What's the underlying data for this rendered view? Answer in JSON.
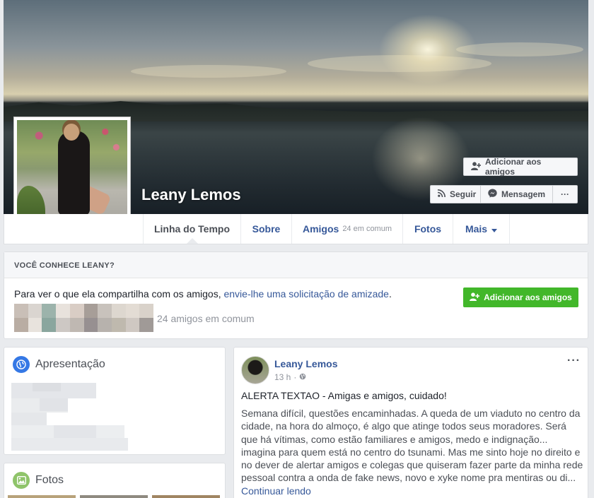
{
  "profile": {
    "name": "Leany Lemos"
  },
  "cover_actions": {
    "add_friend": "Adicionar aos amigos",
    "follow": "Seguir",
    "message": "Mensagem",
    "more": "···"
  },
  "nav": {
    "timeline": "Linha do Tempo",
    "about": "Sobre",
    "friends": "Amigos",
    "friends_mutual": "24 em comum",
    "photos": "Fotos",
    "more": "Mais"
  },
  "know_box": {
    "heading": "VOCÊ CONHECE LEANY?",
    "text_prefix": "Para ver o que ela compartilha com os amigos, ",
    "link": "envie-lhe uma solicitação de amizade",
    "text_suffix": ".",
    "add_button": "Adicionar aos amigos",
    "mutual_count": "24 amigos em comum",
    "thumb_colors": [
      "#c9bfb7",
      "#dad5d0",
      "#9cb3ab",
      "#e8e2dc",
      "#d9cdc5",
      "#a79e98",
      "#c8c2bc",
      "#ddd7cf",
      "#e3dcd4",
      "#d9d2ca",
      "#b9ada3",
      "#e8e3dd",
      "#8aa69e",
      "#cdc8c4",
      "#bfb8b2",
      "#979091",
      "#b7b2ad",
      "#bfb9ae",
      "#cfc8c2",
      "#a09a97"
    ]
  },
  "intro": {
    "title": "Apresentação"
  },
  "photos": {
    "title": "Fotos"
  },
  "post": {
    "author": "Leany Lemos",
    "time": "13 h",
    "more": "···",
    "alert": "ALERTA TEXTAO - Amigas e amigos, cuidado!",
    "body": "Semana difícil, questões encaminhadas. A queda de um viaduto no centro da cidade, na hora do almoço, é algo que atinge todos seus moradores. Será que há vítimas, como estão familiares e amigos, medo e indignação... imagina para quem está no centro do tsunami. Mas me sinto hoje no direito e no dever de alertar amigos e colegas que quiseram fazer parte da minha rede pessoal contra a onda de fake news, novo e xyke nome pra mentiras ou di...",
    "read_more": "Continuar lendo"
  },
  "colors": {
    "link": "#365899",
    "green": "#42b72a",
    "background": "#e9ebee"
  },
  "icons": [
    "add-friend-icon",
    "rss-icon",
    "messenger-icon",
    "caret-down-icon",
    "globe-icon",
    "photo-icon"
  ]
}
